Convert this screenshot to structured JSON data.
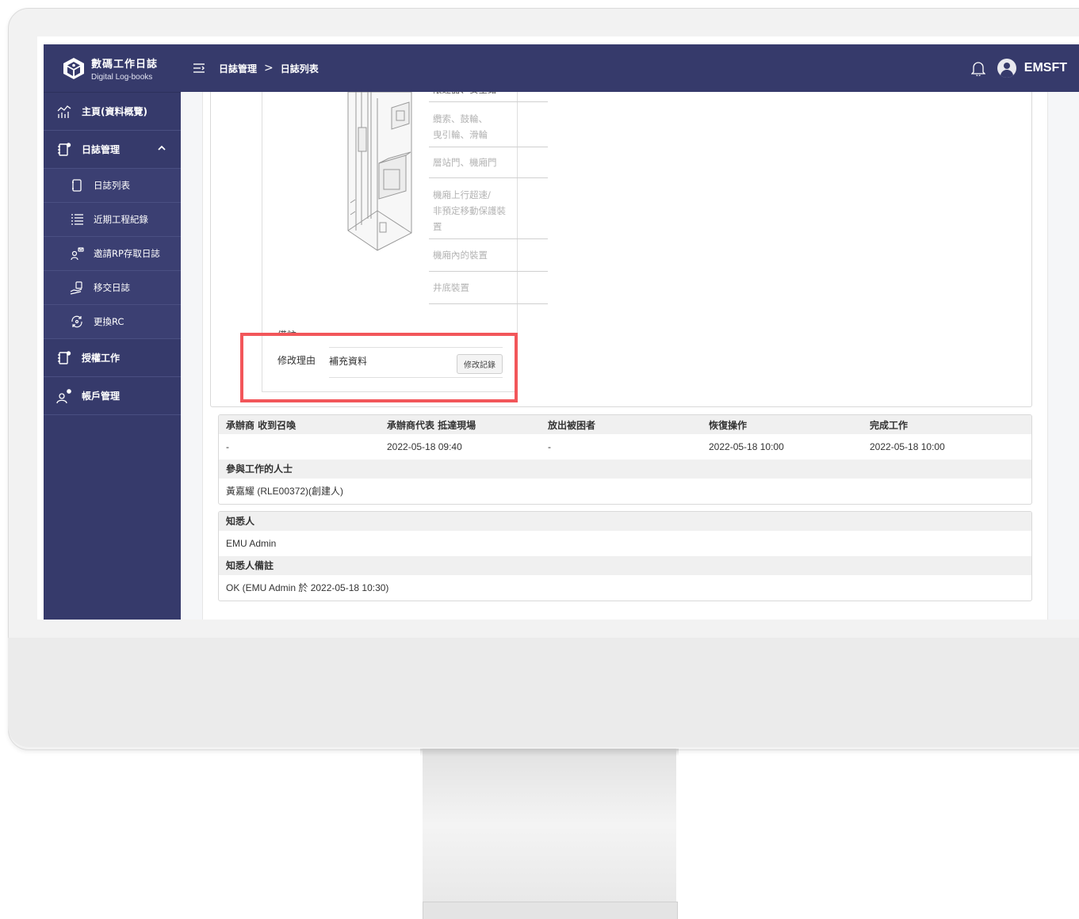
{
  "app": {
    "title": "數碼工作日誌",
    "subtitle": "Digital Log-books",
    "username": "EMSFT"
  },
  "breadcrumb": {
    "items": [
      "日誌管理",
      "日誌列表"
    ],
    "separator": ">"
  },
  "sidebar": {
    "items": [
      {
        "label": "主頁(資料概覽)",
        "icon": "chart-icon"
      },
      {
        "label": "日誌管理",
        "icon": "logbook-icon",
        "expanded": true
      },
      {
        "label": "日誌列表",
        "icon": "notebook-icon"
      },
      {
        "label": "近期工程紀錄",
        "icon": "list-icon"
      },
      {
        "label": "邀請RP存取日誌",
        "icon": "invite-icon"
      },
      {
        "label": "移交日誌",
        "icon": "handover-icon"
      },
      {
        "label": "更換RC",
        "icon": "swap-icon"
      },
      {
        "label": "授權工作",
        "icon": "authorize-icon"
      },
      {
        "label": "帳戶管理",
        "icon": "account-icon"
      }
    ]
  },
  "form": {
    "parts": [
      "限速器、安全鉗",
      "纜索、鼓輪、\n曳引輪、滑輪",
      "層站門、機廂門",
      "機廂上行超速/\n非預定移動保護裝\n置",
      "機廂內的裝置",
      "井底裝置"
    ],
    "remark_label": "備註",
    "reason_label": "修改理由",
    "reason_value": "補充資料",
    "edit_record_button": "修改記錄"
  },
  "times": {
    "headers": [
      "承辦商 收到召喚",
      "承辦商代表 抵達現場",
      "放出被困者",
      "恢復操作",
      "完成工作"
    ],
    "values": [
      "-",
      "2022-05-18 09:40",
      "-",
      "2022-05-18 10:00",
      "2022-05-18 10:00"
    ],
    "participants_label": "參與工作的人士",
    "participants_value": "黃嘉耀 (RLE00372)(創建人)"
  },
  "notified": {
    "label": "知悉人",
    "value": "EMU Admin",
    "remark_label": "知悉人備註",
    "remark_value": "OK (EMU Admin 於 2022-05-18 10:30)"
  },
  "colors": {
    "primary": "#363a6b",
    "highlight": "#f2565a"
  }
}
